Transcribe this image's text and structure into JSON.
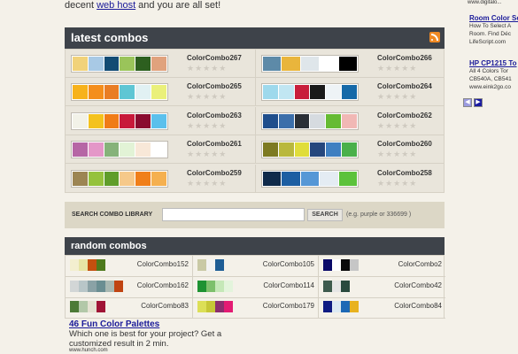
{
  "intro": {
    "before": "decent ",
    "link": "web host",
    "after": " and you are all set!"
  },
  "latest": {
    "title": "latest combos",
    "stars": "★★★★★",
    "combos": [
      {
        "name": "ColorCombo267",
        "colors": [
          "#f1d27a",
          "#a8c9e5",
          "#124b73",
          "#9ac45a",
          "#2d5f1f",
          "#e0a27d"
        ]
      },
      {
        "name": "ColorCombo266",
        "colors": [
          "#5d8aa8",
          "#e9b53c",
          "#dfe6ea",
          "#ffffff",
          "#000000"
        ]
      },
      {
        "name": "ColorCombo265",
        "colors": [
          "#f7b21b",
          "#f48e1c",
          "#e97d24",
          "#5ec6d4",
          "#e1f1f3",
          "#eaf07a"
        ]
      },
      {
        "name": "ColorCombo264",
        "colors": [
          "#9ed9ec",
          "#c1e6f2",
          "#c81e3b",
          "#1a1a1a",
          "#eef3f6",
          "#1669a8"
        ]
      },
      {
        "name": "ColorCombo263",
        "colors": [
          "#f2f2e8",
          "#f4c21d",
          "#f07c17",
          "#c8193a",
          "#8a0b2f",
          "#5bc0ec"
        ]
      },
      {
        "name": "ColorCombo262",
        "colors": [
          "#1f4e8c",
          "#3b6eaa",
          "#2a2f36",
          "#d6dbe0",
          "#66bb33",
          "#f1b8b5"
        ]
      },
      {
        "name": "ColorCombo261",
        "colors": [
          "#b666a5",
          "#e497c8",
          "#86b27a",
          "#e2f3d6",
          "#f8e8d8",
          "#ffffff"
        ]
      },
      {
        "name": "ColorCombo260",
        "colors": [
          "#7d7a22",
          "#b9b83d",
          "#e0dd3a",
          "#25477d",
          "#3f7fc1",
          "#4ab04a"
        ]
      },
      {
        "name": "ColorCombo259",
        "colors": [
          "#9c8553",
          "#95c23d",
          "#5f9d2a",
          "#f6c98a",
          "#f07f19",
          "#f5b04f"
        ]
      },
      {
        "name": "ColorCombo258",
        "colors": [
          "#0f2a4a",
          "#1c5ea2",
          "#5597d6",
          "#e4ecf3",
          "#5cc23b"
        ]
      }
    ]
  },
  "search": {
    "label": "SEARCH COMBO LIBRARY",
    "input_value": "",
    "button": "SEARCH",
    "hint": "(e.g. purple or 336699 )"
  },
  "random": {
    "title": "random combos",
    "combos": [
      {
        "name": "ColorCombo152",
        "colors": [
          "#f3efcf",
          "#e7e4a4",
          "#c4500f",
          "#4e7a1c"
        ]
      },
      {
        "name": "ColorCombo105",
        "colors": [
          "#c9c9a5",
          "#f2f2f2",
          "#1e5d95"
        ]
      },
      {
        "name": "ColorCombo2",
        "colors": [
          "#0a0a68",
          "#ffffff",
          "#0a0a0a",
          "#c6c6c6"
        ]
      },
      {
        "name": "ColorCombo162",
        "colors": [
          "#d2d6d6",
          "#b8c6c8",
          "#8aa2a6",
          "#6a8e92",
          "#a8b8b2",
          "#c04412"
        ]
      },
      {
        "name": "ColorCombo114",
        "colors": [
          "#1e9232",
          "#7dc06c",
          "#c5e8b8",
          "#e3f4dc"
        ]
      },
      {
        "name": "ColorCombo42",
        "colors": [
          "#3d5a4d",
          "#e6e6e6",
          "#2a4a3e"
        ]
      },
      {
        "name": "ColorCombo83",
        "colors": [
          "#4c7a36",
          "#b2c8a8",
          "#e5e2d2",
          "#a01436"
        ]
      },
      {
        "name": "ColorCombo179",
        "colors": [
          "#dcdf57",
          "#c6c737",
          "#8c2e6e",
          "#e31b73"
        ]
      },
      {
        "name": "ColorCombo84",
        "colors": [
          "#0e1b82",
          "#ddeaf3",
          "#1c68b5",
          "#e8b21f"
        ]
      }
    ]
  },
  "ad": {
    "title": "46 Fun Color Palettes",
    "body": "Which one is best for your project? Get a customized result in 2 min.",
    "url": "www.hunch.com"
  },
  "sidebar_ads": {
    "top_url": "www.digitalo...",
    "ads": [
      {
        "title": "Room Color Se",
        "lines": [
          "How To Select A",
          "Room. Find Déc",
          "LifeScript.com"
        ]
      },
      {
        "title": "HP CP1215 To",
        "lines": [
          "All 4 Colors Tor",
          "CB540A, CB541",
          "www.eink2go.co"
        ]
      }
    ],
    "prev": "◀",
    "next": "▶"
  }
}
